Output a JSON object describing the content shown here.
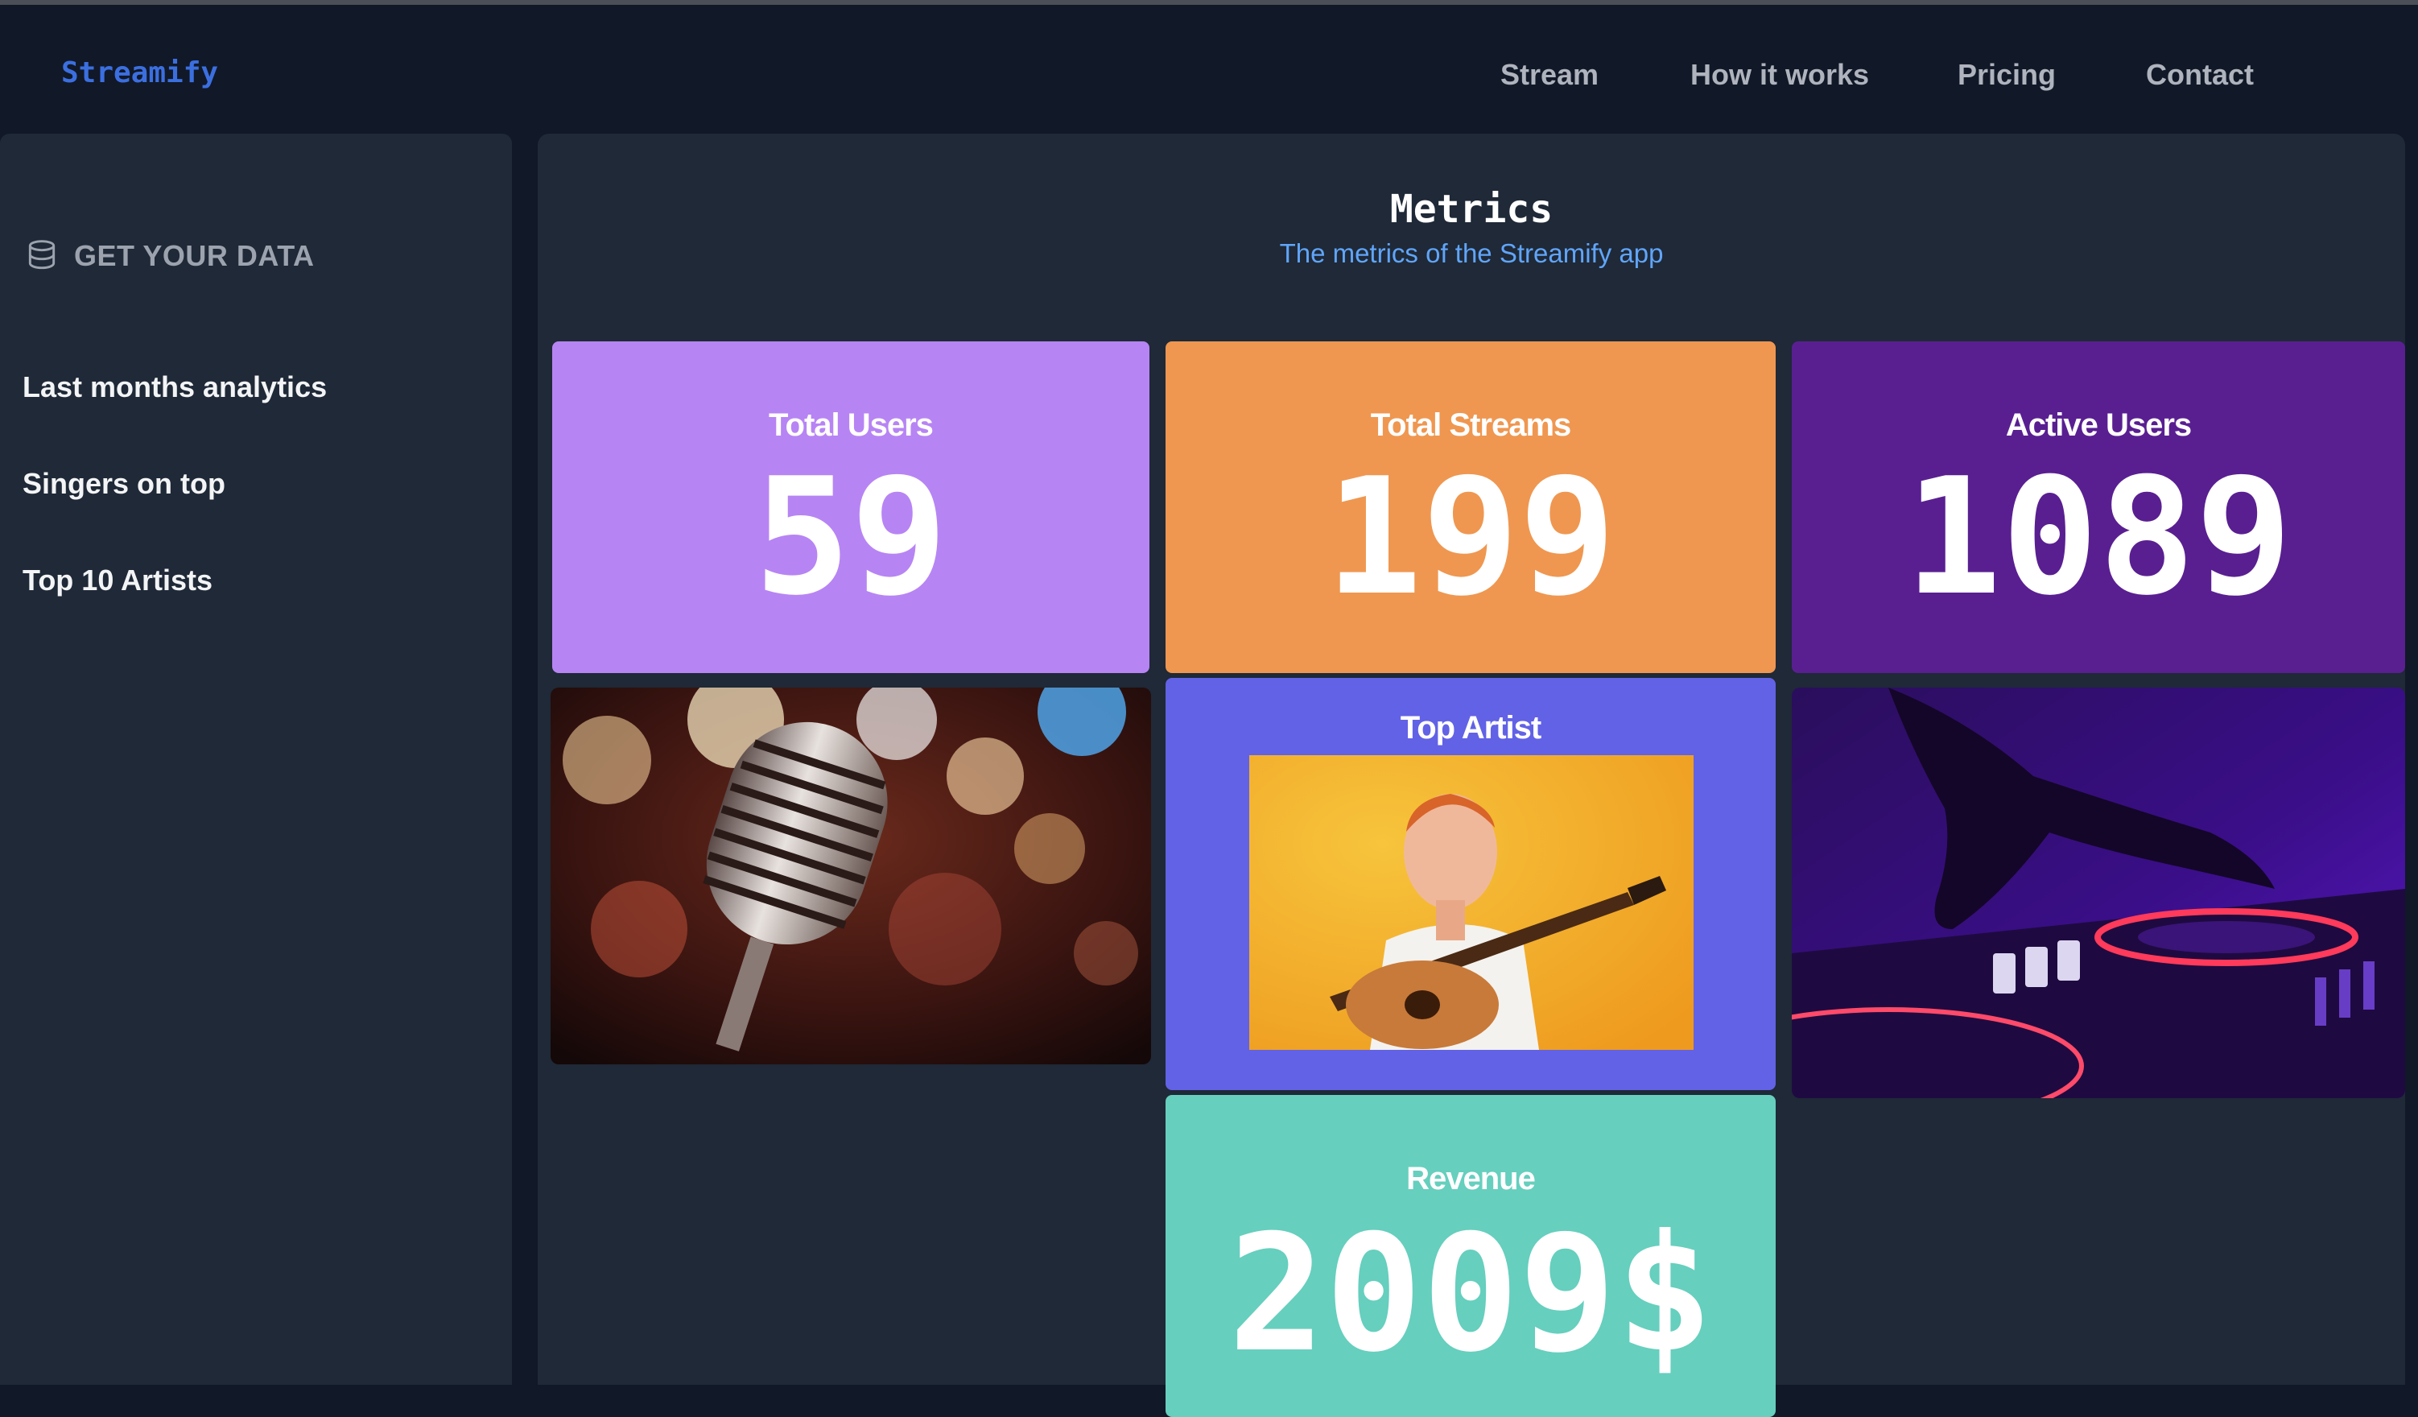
{
  "header": {
    "brand": "Streamify",
    "nav": [
      "Stream",
      "How it works",
      "Pricing",
      "Contact"
    ]
  },
  "sidebar": {
    "heading": "GET YOUR DATA",
    "heading_icon": "database-icon",
    "items": [
      "Last months analytics",
      "Singers on top",
      "Top 10 Artists"
    ]
  },
  "main": {
    "title": "Metrics",
    "subtitle": "The metrics of the Streamify app",
    "cards": {
      "total_users": {
        "label": "Total Users",
        "value": "59",
        "color": "#b784f4"
      },
      "total_streams": {
        "label": "Total Streams",
        "value": "199",
        "color": "#ef9750"
      },
      "active_users": {
        "label": "Active Users",
        "value": "1089",
        "color": "#591f91"
      },
      "top_artist": {
        "label": "Top Artist",
        "color": "#6262e6"
      },
      "revenue": {
        "label": "Revenue",
        "value": "2009$",
        "color": "#66cfbe"
      }
    },
    "images": [
      "microphone-photo",
      "top-artist-photo",
      "dj-turntable-photo"
    ]
  },
  "colors": {
    "background": "#111827",
    "panel": "#1f2937",
    "brand": "#3b6fe0",
    "subtitle": "#60a5fa"
  }
}
